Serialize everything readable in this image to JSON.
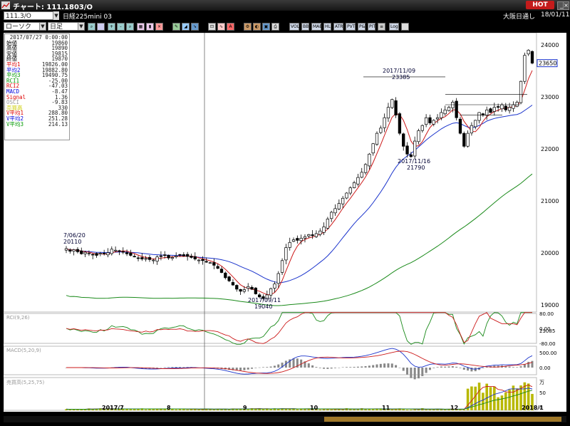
{
  "app": {
    "title": "チャート: 111.1803/O"
  },
  "symbol": {
    "code": "111.3/O",
    "name": "日経225mini 03",
    "exchange": "大阪日通し",
    "date": "18/01/11"
  },
  "toolbar": {
    "chart_type": "ローソク",
    "period": "日足",
    "labels": {
      "vol": "VOL",
      "bb": "BB",
      "mae": "MAE",
      "hl": "HL",
      "atr": "ATR",
      "pvt": "PVT",
      "pt": "P&T",
      "pit": "PIT",
      "log": "Log"
    }
  },
  "hot_label": "HOT",
  "info": {
    "datetime": "2017/07/27 0:00:00",
    "rows": [
      {
        "k": "始値",
        "v": "19860",
        "c": "#000"
      },
      {
        "k": "高値",
        "v": "19890",
        "c": "#000"
      },
      {
        "k": "安値",
        "v": "19815",
        "c": "#000"
      },
      {
        "k": "終値",
        "v": "19870",
        "c": "#000"
      },
      {
        "k": "平均1",
        "v": "19826.00",
        "c": "#d00"
      },
      {
        "k": "平均2",
        "v": "19882.80",
        "c": "#00d"
      },
      {
        "k": "平均3",
        "v": "19490.75",
        "c": "#090"
      },
      {
        "k": "RCI1",
        "v": "-25.00",
        "c": "#090"
      },
      {
        "k": "RCI2",
        "v": "-47.03",
        "c": "#d00"
      },
      {
        "k": "MACD",
        "v": "-8.47",
        "c": "#00d"
      },
      {
        "k": "Signal",
        "v": "1.36",
        "c": "#d00"
      },
      {
        "k": "OSCI",
        "v": "-9.83",
        "c": "#999"
      },
      {
        "k": "売買高",
        "v": "330",
        "c": "#cc0"
      },
      {
        "k": "V平均1",
        "v": "288.80",
        "c": "#d00"
      },
      {
        "k": "V平均2",
        "v": "251.28",
        "c": "#00d"
      },
      {
        "k": "V平均3",
        "v": "214.13",
        "c": "#090"
      }
    ]
  },
  "chart_data": {
    "type": "candlestick",
    "ylim": [
      18860,
      24180
    ],
    "yticks": [
      "24000",
      "23000",
      "22000",
      "21000",
      "20000",
      "19000"
    ],
    "current_price": "23650",
    "month_labels": [
      "2017/7",
      "8",
      "9",
      "10",
      "11",
      "12",
      "2018/1"
    ],
    "annotations": [
      {
        "date": "7/06/20",
        "value": "20110"
      },
      {
        "date": "2017/09/11",
        "value": "19040"
      },
      {
        "date": "2017/11/09",
        "value": "23385"
      },
      {
        "date": "2017/11/16",
        "value": "21790"
      }
    ],
    "rci": {
      "label": "RCI(9,26)",
      "ticks": [
        "80.00",
        "0.00",
        "-80.00"
      ],
      "value": "23085",
      "series": [
        {
          "name": "RCI1"
        },
        {
          "name": "RCI2"
        }
      ]
    },
    "macd": {
      "label": "MACD(5,20,9)",
      "ticks": [
        "500.00",
        "0.00"
      ]
    },
    "volume": {
      "label": "売買高(5,25,75)",
      "ticks": [
        "万",
        "50",
        "0"
      ]
    },
    "closes": [
      20080,
      20030,
      20060,
      20020,
      19980,
      20010,
      19990,
      19960,
      19950,
      19990,
      19980,
      20000,
      20070,
      20050,
      20040,
      20020,
      19980,
      19950,
      19930,
      19900,
      19880,
      19890,
      19870,
      19860,
      19920,
      19940,
      19950,
      19900,
      19910,
      19940,
      19960,
      19940,
      19930,
      19910,
      19880,
      19860,
      19850,
      19830,
      19810,
      19760,
      19700,
      19620,
      19520,
      19460,
      19380,
      19300,
      19260,
      19290,
      19350,
      19300,
      19210,
      19150,
      19120,
      19190,
      19310,
      19400,
      19600,
      19850,
      20100,
      20200,
      20250,
      20240,
      20280,
      20310,
      20350,
      20330,
      20370,
      20420,
      20500,
      20650,
      20780,
      20850,
      20950,
      21050,
      21150,
      21250,
      21350,
      21450,
      21550,
      21700,
      21900,
      22100,
      22300,
      22400,
      22600,
      22800,
      22950,
      22650,
      22300,
      22050,
      21900,
      21850,
      22150,
      22350,
      22450,
      22600,
      22500,
      22550,
      22600,
      22700,
      22750,
      22800,
      22900,
      22600,
      22300,
      22050,
      22300,
      22450,
      22550,
      22700,
      22650,
      22750,
      22700,
      22800,
      22800,
      22850,
      22750,
      22800,
      22850,
      22900,
      23300,
      23800,
      23900,
      23650
    ]
  }
}
